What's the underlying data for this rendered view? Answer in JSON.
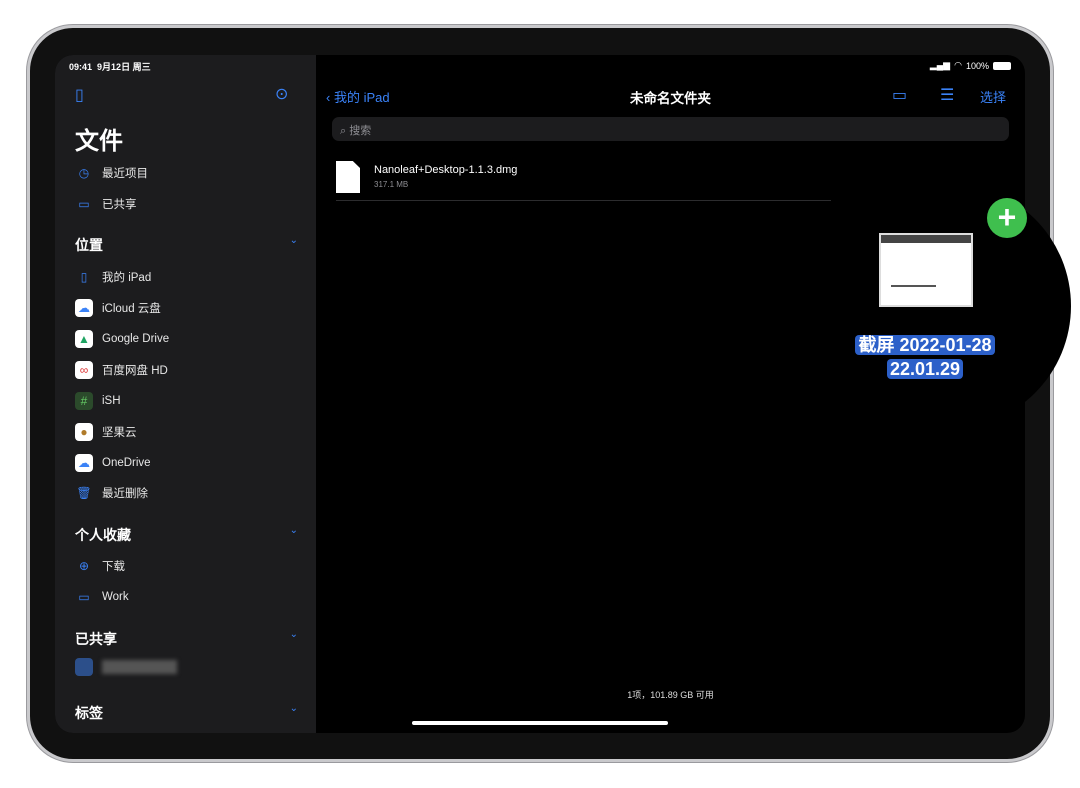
{
  "status": {
    "time": "09:41",
    "date": "9月12日 周三",
    "battery": "100%"
  },
  "sidebar": {
    "title": "文件",
    "top_items": [
      {
        "label": "最近项目",
        "icon": "clock-icon"
      },
      {
        "label": "已共享",
        "icon": "shared-folder-icon"
      }
    ],
    "sections": [
      {
        "title": "位置",
        "items": [
          {
            "label": "我的 iPad",
            "icon": "ipad-icon"
          },
          {
            "label": "iCloud 云盘",
            "icon": "icloud-icon"
          },
          {
            "label": "Google Drive",
            "icon": "google-drive-icon"
          },
          {
            "label": "百度网盘 HD",
            "icon": "baidu-icon"
          },
          {
            "label": "iSH",
            "icon": "ish-icon"
          },
          {
            "label": "坚果云",
            "icon": "jianguoyun-icon"
          },
          {
            "label": "OneDrive",
            "icon": "onedrive-icon"
          },
          {
            "label": "最近删除",
            "icon": "trash-icon"
          }
        ]
      },
      {
        "title": "个人收藏",
        "items": [
          {
            "label": "下载",
            "icon": "download-icon"
          },
          {
            "label": "Work",
            "icon": "folder-icon"
          }
        ]
      },
      {
        "title": "已共享",
        "items": []
      },
      {
        "title": "标签",
        "items": []
      }
    ]
  },
  "main": {
    "back_label": "我的 iPad",
    "title": "未命名文件夹",
    "select_label": "选择",
    "search_placeholder": "搜索",
    "files": [
      {
        "name": "Nanoleaf+Desktop-1.1.3.dmg",
        "size": "317.1 MB"
      }
    ],
    "footer": "1项，101.89 GB 可用"
  },
  "drag_preview": {
    "line1": "截屏 2022-01-28",
    "line2": "22.01.29",
    "badge": "+"
  },
  "colors": {
    "accent": "#3a82f7",
    "add_badge": "#3fbf4e",
    "sidebar_bg": "#1c1c1e"
  }
}
